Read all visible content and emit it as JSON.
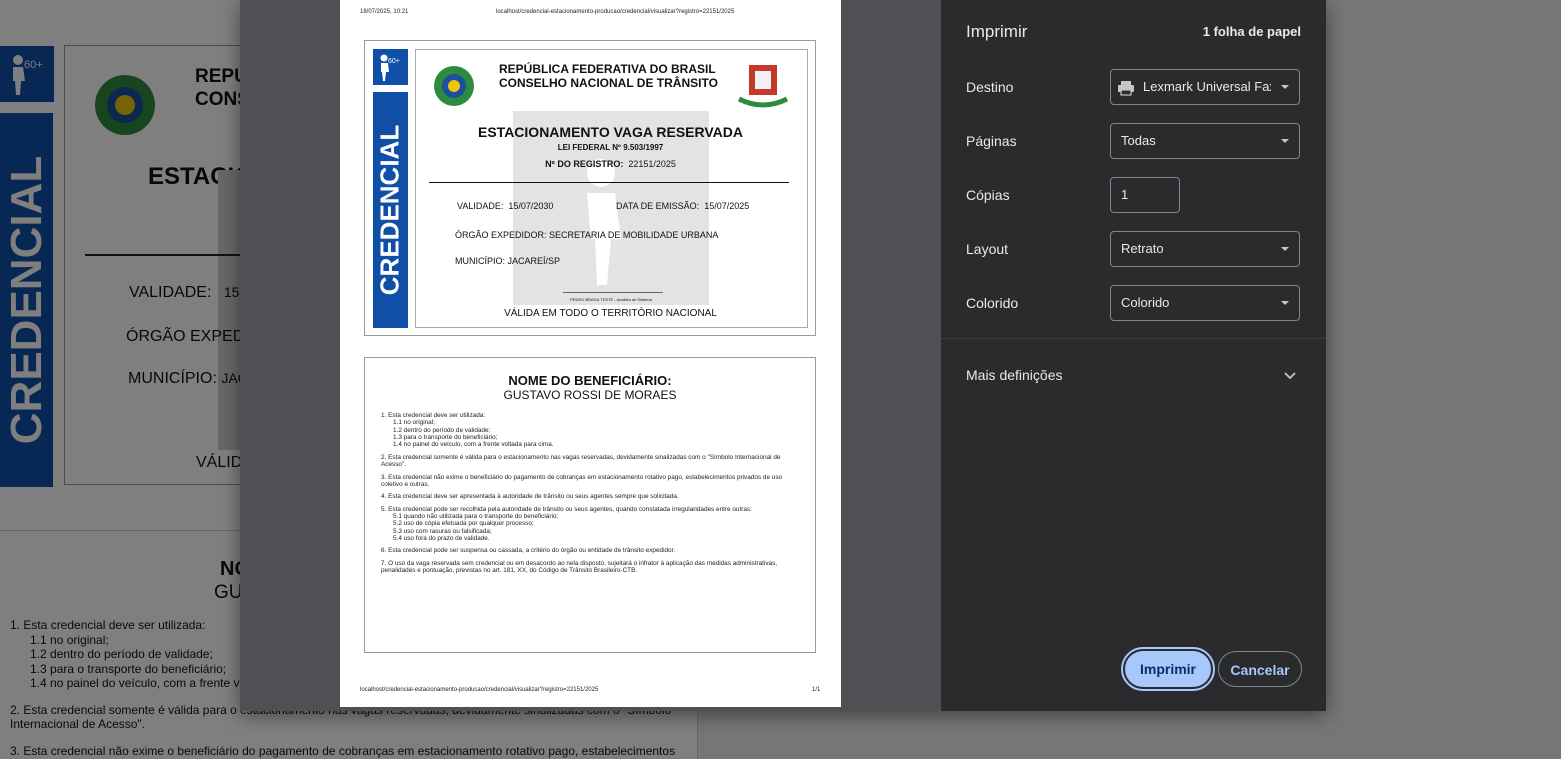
{
  "background_page": {
    "side_label": "CREDENCIAL",
    "badge_text": "60+",
    "title_1": "REPU",
    "title_2": "CONS",
    "heading": "ESTACIO",
    "validity_label": "VALIDADE:",
    "validity_partial": "15",
    "organ_label": "ÓRGÃO EXPED",
    "city_label": "MUNICÍPIO:",
    "city_partial": "JAC",
    "valid_partial": "VÁLID",
    "name_partial": "NO",
    "name2_partial": "GU",
    "rules": [
      "1. Esta credencial deve ser utilizada:",
      "1.1  no original;",
      "1.2 dentro do período de validade;",
      "1.3 para o transporte do beneficiário;",
      "1.4 no painel do veículo, com a frente vo",
      "2. Esta credencial somente é válida para o estacionamento nas vagas reservadas, devidamente sinalizadas com o \"Símbolo",
      "Internacional de Acesso\".",
      "3. Esta credencial não exime o beneficiário do pagamento de cobranças em estacionamento rotativo pago, estabelecimentos"
    ]
  },
  "preview": {
    "header_date": "18/07/2025, 10:21",
    "header_url": "localhost/credencial-estacionamento-producao/credencial/visualizar?registro=22151/2025",
    "footer_url": "localhost/credencial-estacionamento-producao/credencial/visualizar?registro=22151/2025",
    "footer_page": "1/1",
    "badge_text": "60+",
    "side_label": "CREDENCIAL",
    "republic": "REPÚBLICA FEDERATIVA DO BRASIL",
    "council": "CONSELHO NACIONAL DE TRÂNSITO",
    "title": "ESTACIONAMENTO VAGA RESERVADA",
    "law": "LEI FEDERAL Nº 9.503/1997",
    "registry_label": "Nº DO REGISTRO:",
    "registry_value": "22151/2025",
    "validity_label": "VALIDADE:",
    "validity_value": "15/07/2030",
    "issue_label": "DATA DE EMISSÃO:",
    "issue_value": "15/07/2025",
    "organ_label": "ÓRGÃO EXPEDIDOR:",
    "organ_value": "SECRETARIA DE MOBILIDADE URBANA",
    "city_label": "MUNICÍPIO:",
    "city_value": "JACAREÍ/SP",
    "signature": "PEDRO BRAGA TESTE - Analista de Sistema",
    "valid_everywhere": "VÁLIDA EM TODO O TERRITÓRIO NACIONAL",
    "beneficiary_label": "NOME DO BENEFICIÁRIO:",
    "beneficiary_name": "GUSTAVO ROSSI DE MORAES",
    "rules": [
      {
        "text": "1. Esta credencial deve ser utilizada:",
        "indent": 0
      },
      {
        "text": "1.1  no original;",
        "indent": 1
      },
      {
        "text": "1.2 dentro do período de validade;",
        "indent": 1
      },
      {
        "text": "1.3 para o transporte do beneficiário;",
        "indent": 1
      },
      {
        "text": "1.4 no painel do veículo, com a frente voltada para cima.",
        "indent": 1
      },
      {
        "text": "2. Esta credencial somente é válida para o estacionamento nas vagas reservadas, devidamente sinalizadas com o \"Símbolo Internacional de Acesso\".",
        "indent": 0,
        "gap": true
      },
      {
        "text": "3. Esta credencial não exime o beneficiário do pagamento de cobranças em estacionamento rotativo pago, estabelecimentos privados de uso coletivo e outras.",
        "indent": 0,
        "gap": true
      },
      {
        "text": "4. Esta credencial deve ser apresentada à autoridade de trânsito ou seus agentes sempre que solicitada.",
        "indent": 0,
        "gap": true
      },
      {
        "text": "5. Esta credencial pode ser recolhida pela autoridade de trânsito ou seus agentes, quando constatada irregularidades entre outras:",
        "indent": 0,
        "gap": true
      },
      {
        "text": "5.1 quando não utilizada para o transporte do beneficiário;",
        "indent": 1
      },
      {
        "text": "5.2 uso de cópia efetuada por qualquer processo;",
        "indent": 1
      },
      {
        "text": "5.3 uso com rasuras ou falsificada;",
        "indent": 1
      },
      {
        "text": "5.4 uso fora do prazo de validade.",
        "indent": 1
      },
      {
        "text": "6. Esta credencial pode ser suspensa ou cassada, a critério do órgão ou entidade de trânsito expedidor.",
        "indent": 0,
        "gap": true
      },
      {
        "text": "7. O uso da vaga reservada sem credencial ou em desacordo ao nela disposto, sujeitará o infrator à aplicação das medidas administrativas, penalidades e pontuação, previstas no art. 181, XX, do Código de Trânsito Brasileiro-CTB.",
        "indent": 0,
        "gap": true
      }
    ]
  },
  "print_settings": {
    "title": "Imprimir",
    "sheets": "1 folha de papel",
    "destination_label": "Destino",
    "destination_value": "Lexmark Universal Fax (",
    "pages_label": "Páginas",
    "pages_value": "Todas",
    "copies_label": "Cópias",
    "copies_value": "1",
    "layout_label": "Layout",
    "layout_value": "Retrato",
    "color_label": "Colorido",
    "color_value": "Colorido",
    "more_settings": "Mais definições",
    "print_button": "Imprimir",
    "cancel_button": "Cancelar"
  },
  "colors": {
    "credential_blue": "#0f4fa8",
    "dialog_bg": "#2a2b2d",
    "accent": "#8ab4f8"
  }
}
